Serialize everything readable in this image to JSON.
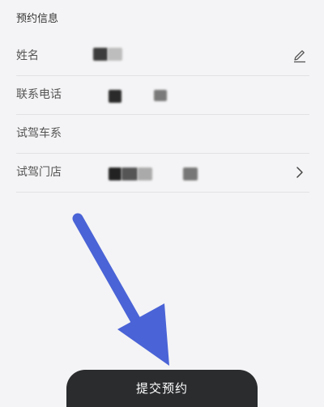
{
  "section": {
    "title": "预约信息"
  },
  "fields": [
    {
      "label": "姓名"
    },
    {
      "label": "联系电话"
    },
    {
      "label": "试驾车系"
    },
    {
      "label": "试驾门店"
    }
  ],
  "icons": {
    "edit": "pencil-icon",
    "store_arrow": "chevron-right-icon",
    "annotation": "arrow-pointer"
  },
  "submit_button": {
    "label": "提交预约"
  },
  "colors": {
    "button_bg": "#2a2c2e",
    "arrow": "#4a63d6",
    "background": "#f4f4f6"
  }
}
